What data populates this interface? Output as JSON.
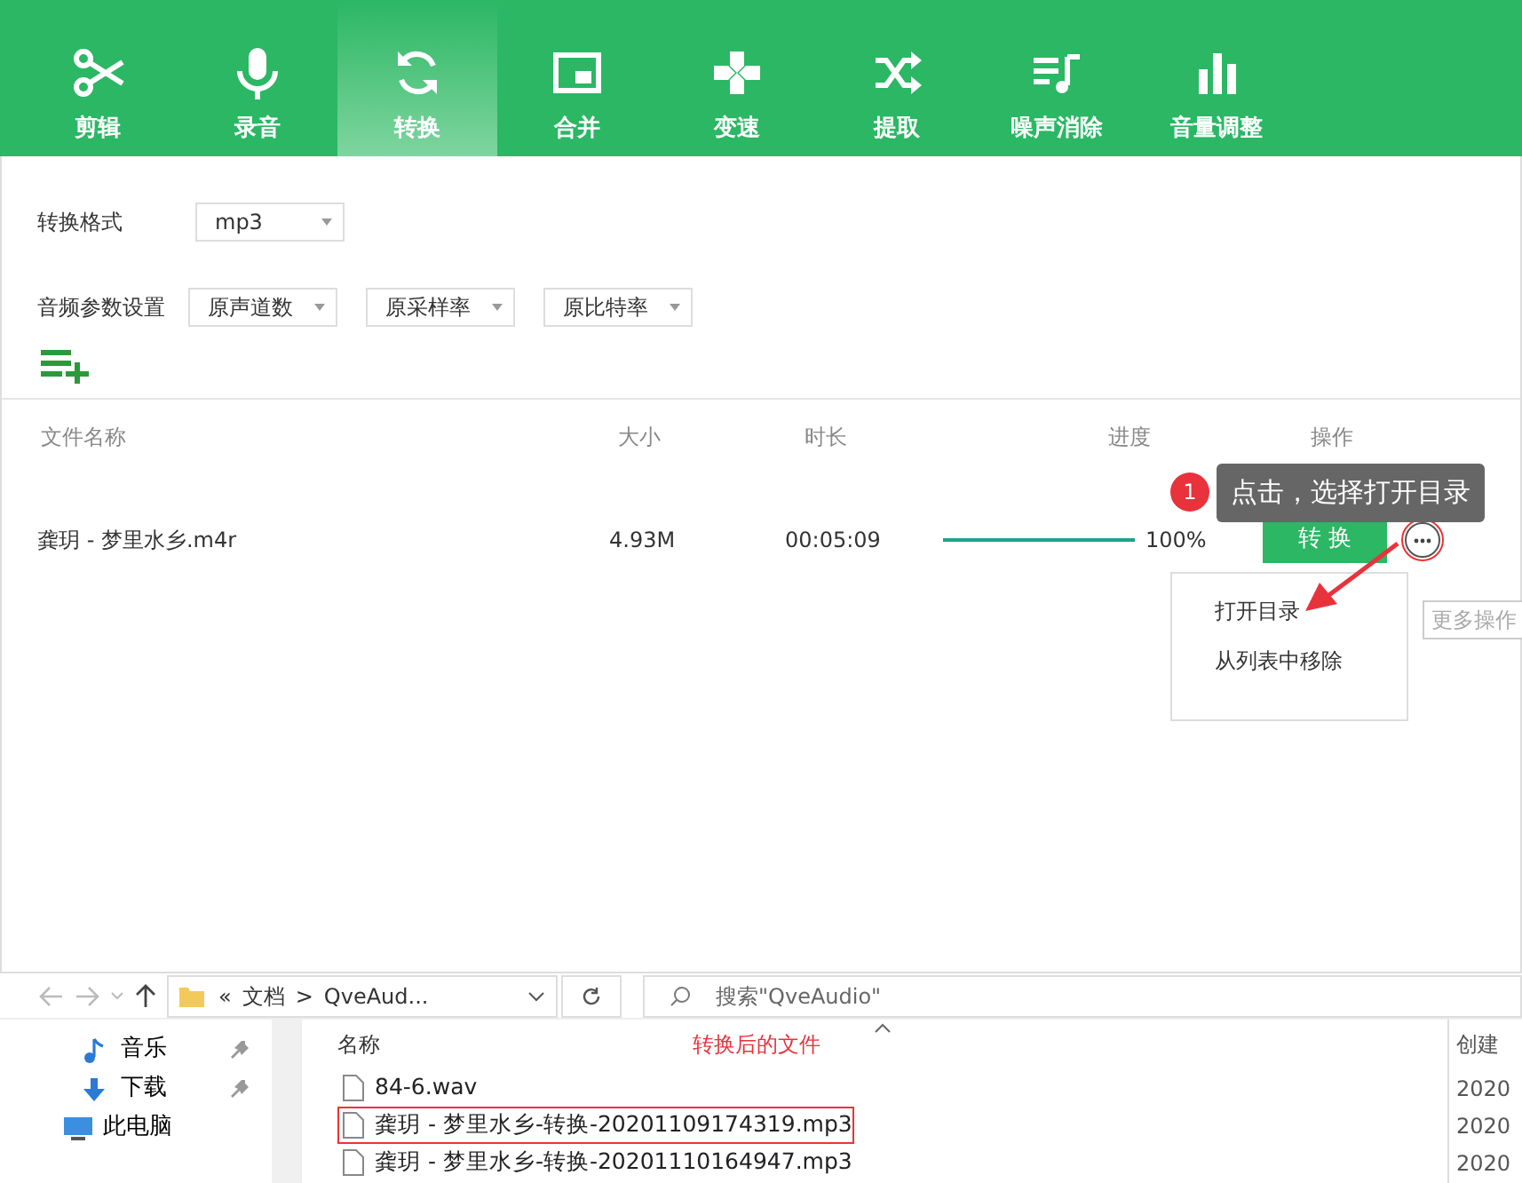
{
  "toolbar": {
    "tabs": [
      {
        "label": "剪辑",
        "kind": "scissors",
        "selected": false
      },
      {
        "label": "录音",
        "kind": "mic",
        "selected": false
      },
      {
        "label": "转换",
        "kind": "convert",
        "selected": true
      },
      {
        "label": "合并",
        "kind": "merge",
        "selected": false
      },
      {
        "label": "变速",
        "kind": "speed",
        "selected": false
      },
      {
        "label": "提取",
        "kind": "shuffle",
        "selected": false
      },
      {
        "label": "噪声消除",
        "kind": "noise",
        "selected": false
      },
      {
        "label": "音量调整",
        "kind": "volume",
        "selected": false
      }
    ]
  },
  "settings": {
    "format_label": "转换格式",
    "format": "mp3",
    "params_label": "音频参数设置",
    "params": [
      "原声道数",
      "原采样率",
      "原比特率"
    ]
  },
  "file_table": {
    "columns": [
      "文件名称",
      "大小",
      "时长",
      "进度",
      "操作"
    ],
    "rows": [
      {
        "name": "龚玥 - 梦里水乡.m4r",
        "size": "4.93M",
        "duration": "00:05:09",
        "level": 1,
        "progress": "100%",
        "action": "转 换"
      }
    ]
  },
  "guide": {
    "step": "1",
    "text": "点击，选择打开目录"
  },
  "more_menu": {
    "items": [
      "打开目录",
      "从列表中移除"
    ],
    "hint": "更多操作"
  },
  "explorer": {
    "path_prefix": "«",
    "path_separator": ">",
    "path": [
      "文档",
      "QveAud..."
    ],
    "search_placeholder": "搜索\"QveAudio\"",
    "nav": [
      {
        "label": "音乐",
        "kind": "music",
        "pinned": true
      },
      {
        "label": "下载",
        "kind": "download",
        "pinned": true
      },
      {
        "label": "此电脑",
        "kind": "pc",
        "pinned": false
      }
    ],
    "columns": [
      "名称",
      "创建"
    ],
    "annotation": "转换后的文件",
    "files": [
      {
        "name": "84-6.wav",
        "created": "2020",
        "highlighted": false
      },
      {
        "name": "龚玥 - 梦里水乡-转换-20201109174319.mp3",
        "created": "2020",
        "highlighted": true
      },
      {
        "name": "龚玥 - 梦里水乡-转换-20201110164947.mp3",
        "created": "2020",
        "highlighted": false
      }
    ]
  }
}
